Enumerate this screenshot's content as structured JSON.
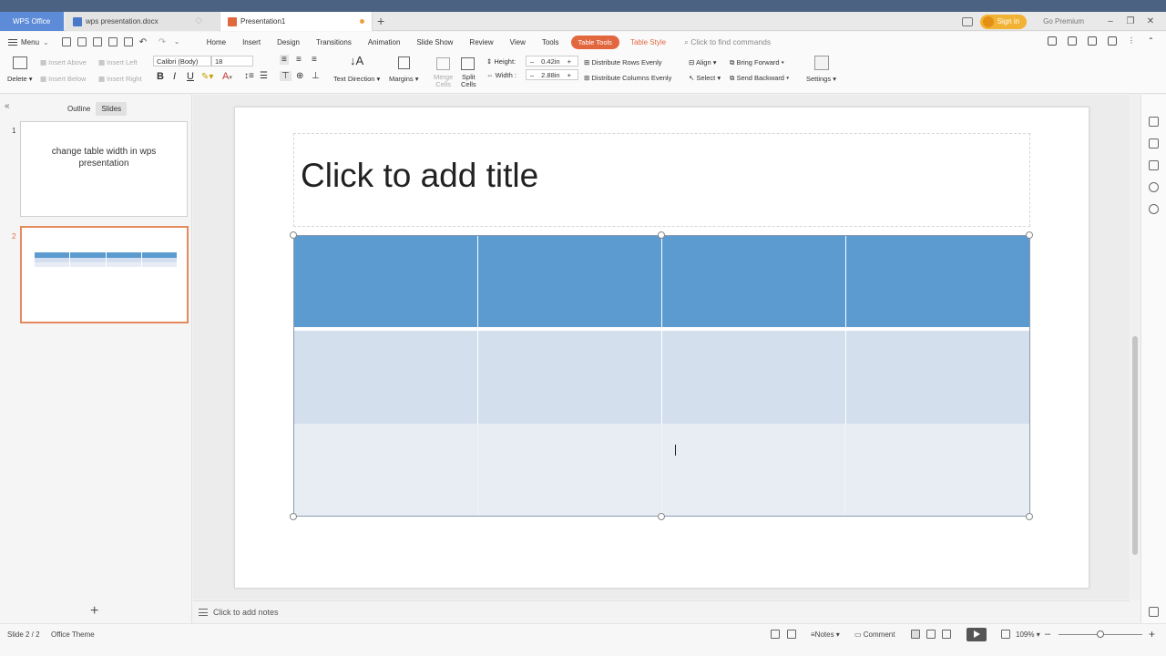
{
  "tabs": [
    {
      "label": "WPS Office"
    },
    {
      "label": "wps presentation.docx"
    },
    {
      "label": "Presentation1"
    }
  ],
  "titlebar": {
    "sign_in": "Sign in",
    "premium": "Go Premium"
  },
  "menubar": {
    "menu_label": "Menu",
    "items": [
      "Home",
      "Insert",
      "Design",
      "Transitions",
      "Animation",
      "Slide Show",
      "Review",
      "View",
      "Tools"
    ],
    "table_tools": "Table Tools",
    "table_style": "Table Style",
    "find_placeholder": "Click to find commands"
  },
  "ribbon": {
    "delete": "Delete",
    "insert_above": "Insert Above",
    "insert_left": "Insert Left",
    "insert_below": "Insert Below",
    "insert_right": "Insert Right",
    "font_name": "Calibri (Body)",
    "font_size": "18",
    "bold": "B",
    "italic": "I",
    "underline": "U",
    "text_direction": "Text Direction",
    "margins": "Margins",
    "merge_cells_1": "Merge",
    "merge_cells_2": "Cells",
    "split_cells_1": "Split",
    "split_cells_2": "Cells",
    "height_label": "Height:",
    "height_value": "0.42in",
    "width_label": "Width :",
    "width_value": "2.88in",
    "distribute_rows": "Distribute Rows Evenly",
    "distribute_columns": "Distribute Columns Evenly",
    "align": "Align",
    "select": "Select",
    "bring_forward": "Bring Forward",
    "send_backward": "Send Backward",
    "settings": "Settings"
  },
  "left_pane": {
    "tab_outline": "Outline",
    "tab_slides": "Slides",
    "slides": [
      {
        "number": "1",
        "title": "change table width in wps presentation"
      },
      {
        "number": "2"
      }
    ]
  },
  "slide": {
    "title_placeholder": "Click to add title",
    "table": {
      "rows": 3,
      "columns": 4
    }
  },
  "notes": {
    "placeholder": "Click to add notes"
  },
  "statusbar": {
    "slide_info": "Slide 2 / 2",
    "theme": "Office Theme",
    "notes": "Notes",
    "comment": "Comment",
    "zoom": "109%"
  },
  "colors": {
    "accent": "#e2673f",
    "table_header": "#5b9bd0",
    "table_band": "#d3dfed",
    "table_light": "#e8edf4",
    "title_strip": "#4b6283"
  }
}
